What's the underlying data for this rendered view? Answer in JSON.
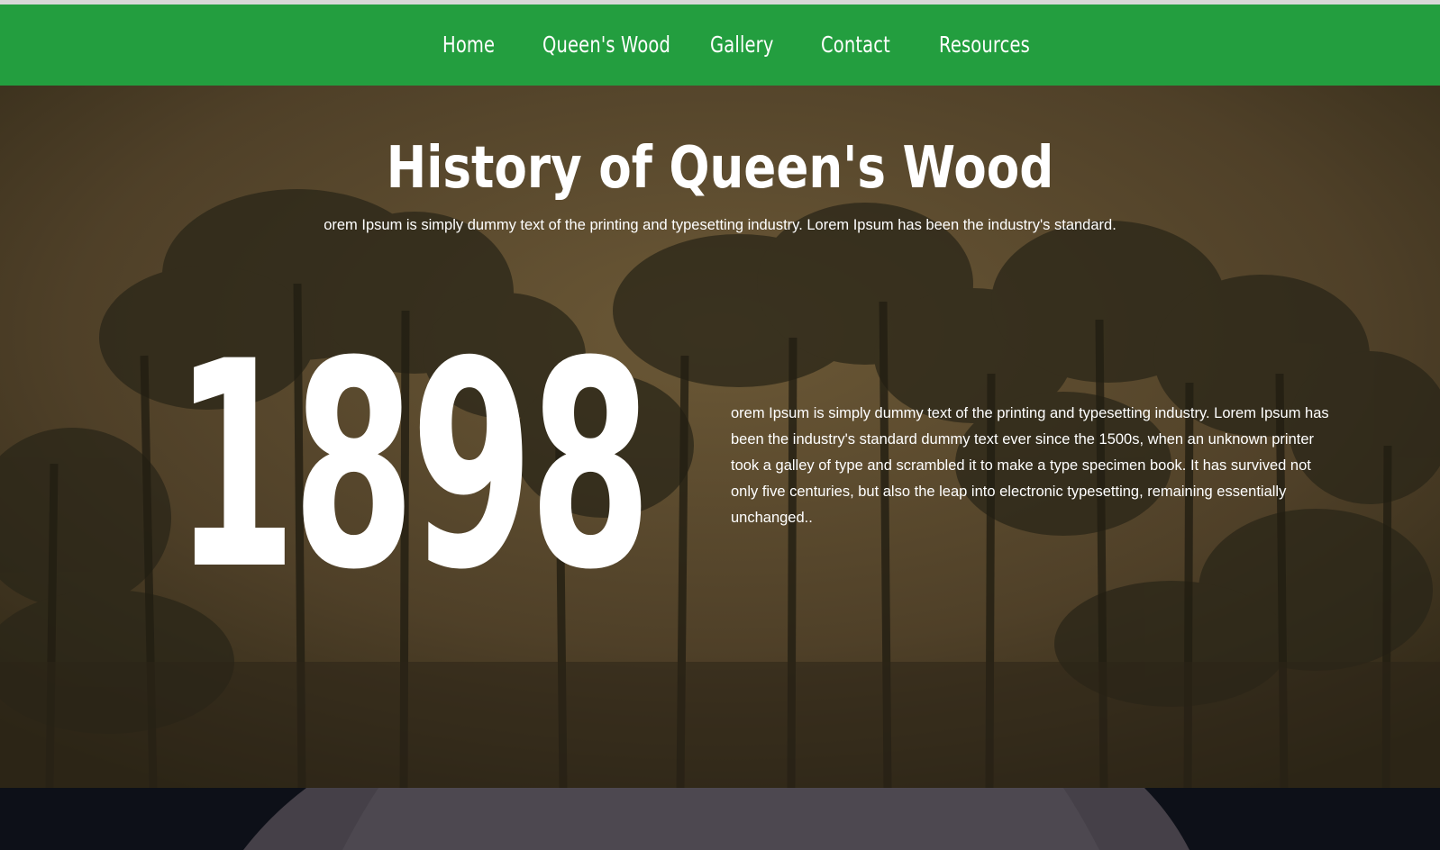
{
  "nav": {
    "items": [
      {
        "label": "Home"
      },
      {
        "label": "Queen's Wood"
      },
      {
        "label": "Gallery"
      },
      {
        "label": "Contact"
      },
      {
        "label": "Resources"
      }
    ]
  },
  "hero": {
    "title": "History of Queen's Wood",
    "intro": "orem Ipsum is simply dummy text of the printing and typesetting industry. Lorem Ipsum has been the industry's standard.",
    "year": "1898",
    "body": "orem Ipsum is simply dummy text of the printing and typesetting industry. Lorem Ipsum has been the industry's standard dummy text ever since the 1500s, when an unknown printer took a galley of type and scrambled it to make a type specimen book. It has survived not only five centuries, but also the leap into electronic typesetting, remaining essentially unchanged.."
  },
  "colors": {
    "nav_bg": "#239e3f",
    "hero_tint": "#5a4a2e",
    "text": "#ffffff",
    "bottom_bg": "#0d1018"
  }
}
